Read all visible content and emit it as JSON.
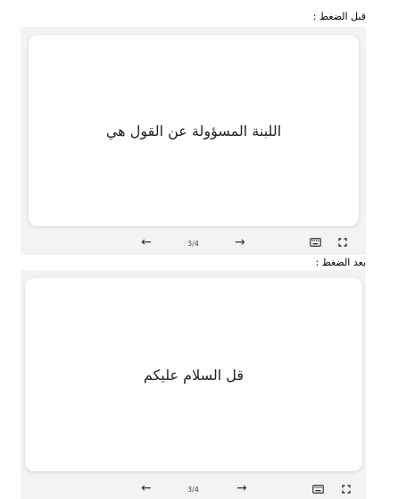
{
  "before": {
    "label": "قبل الضغط :",
    "card_text": "اللبنة المسؤولة عن القول هي",
    "page_indicator": "3/4",
    "prev_icon": "arrow-left-icon",
    "next_icon": "arrow-right-icon",
    "keyboard_icon": "keyboard-icon",
    "fullscreen_icon": "fullscreen-icon"
  },
  "after": {
    "label": "بعد الضغط :",
    "card_text": "قل السلام عليكم",
    "page_indicator": "3/4",
    "prev_icon": "arrow-left-icon",
    "next_icon": "arrow-right-icon",
    "keyboard_icon": "keyboard-icon",
    "fullscreen_icon": "fullscreen-icon"
  }
}
